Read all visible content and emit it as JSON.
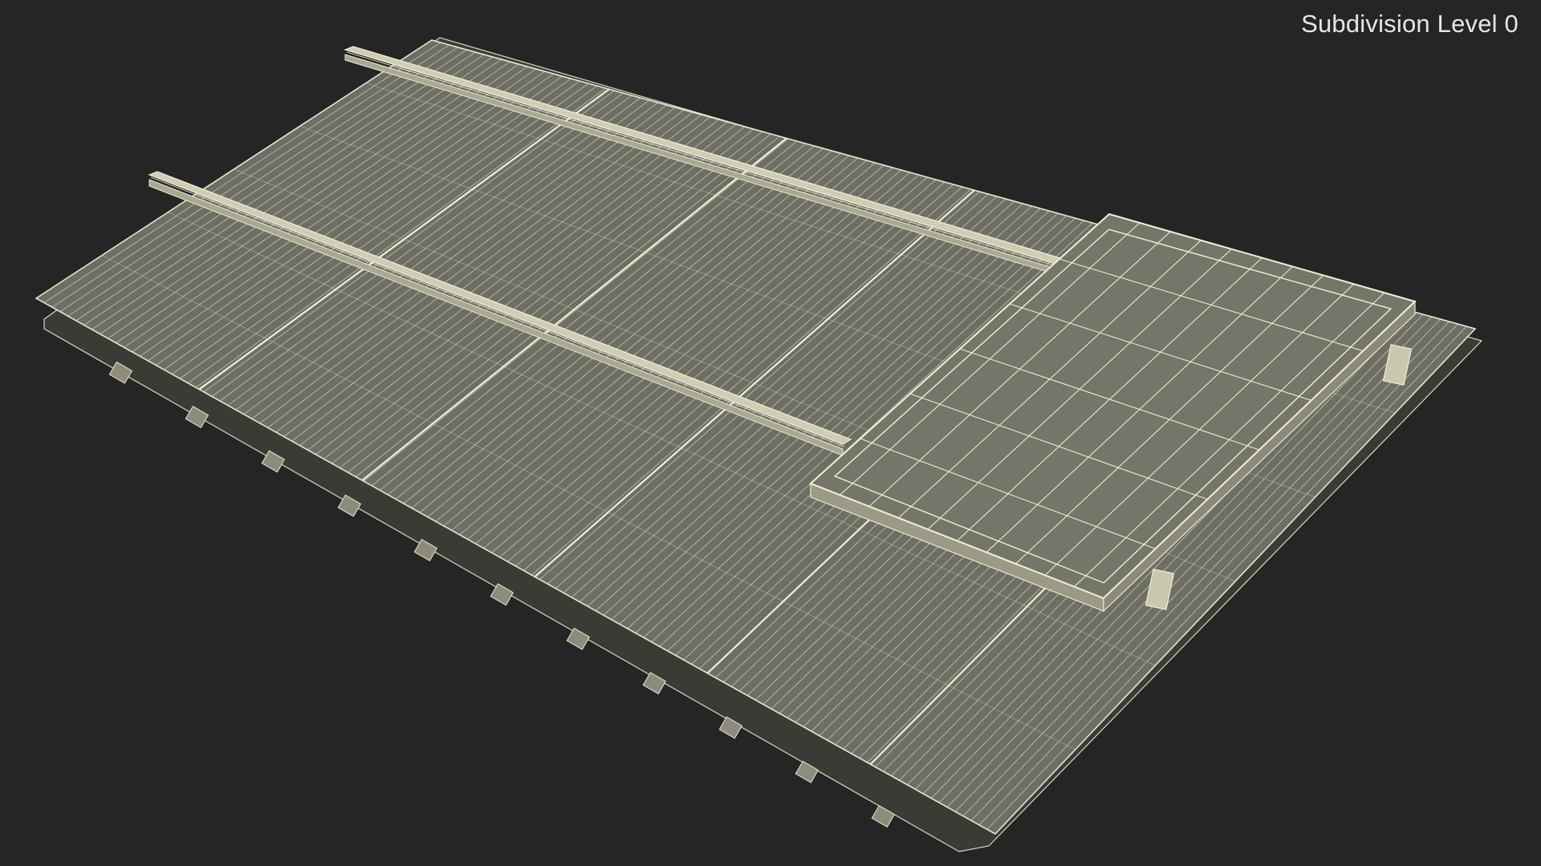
{
  "viewport": {
    "overlay_label": "Subdivision Level 0"
  },
  "scene": {
    "subject": "metal-roof-with-solar-panel-mount-wireframe",
    "colors": {
      "background": "#252525",
      "surface": "#6f6f66",
      "surface_light": "#7a7a70",
      "wire": "#e9e8cf",
      "rail": "#d9d8c2"
    }
  }
}
